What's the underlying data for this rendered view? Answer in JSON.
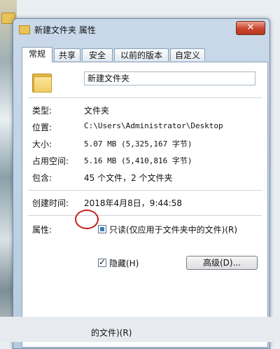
{
  "window": {
    "title": "新建文件夹 属性",
    "close_glyph": "✕"
  },
  "tabs": [
    {
      "label": "常规"
    },
    {
      "label": "共享"
    },
    {
      "label": "安全"
    },
    {
      "label": "以前的版本"
    },
    {
      "label": "自定义"
    }
  ],
  "general": {
    "folder_name": "新建文件夹",
    "rows": [
      {
        "label": "类型:",
        "value": "文件夹"
      },
      {
        "label": "位置:",
        "value": "C:\\Users\\Administrator\\Desktop"
      },
      {
        "label": "大小:",
        "value": "5.07 MB (5,325,167 字节)"
      },
      {
        "label": "占用空间:",
        "value": "5.16 MB (5,410,816 字节)"
      },
      {
        "label": "包含:",
        "value": "45 个文件，2 个文件夹"
      }
    ],
    "created_label": "创建时间:",
    "created_value": "2018年4月8日，9:44:58",
    "attributes_label": "属性:",
    "readonly_label": "只读(仅应用于文件夹中的文件)(R)",
    "readonly_state": "indeterminate",
    "hidden_label": "隐藏(H)",
    "hidden_checked": true,
    "advanced_button": "高级(D)..."
  },
  "bottom": {
    "text": "的文件)(R)"
  },
  "colors": {
    "highlight_circle": "#c3201b",
    "accent_blue": "#2f7fc3"
  }
}
